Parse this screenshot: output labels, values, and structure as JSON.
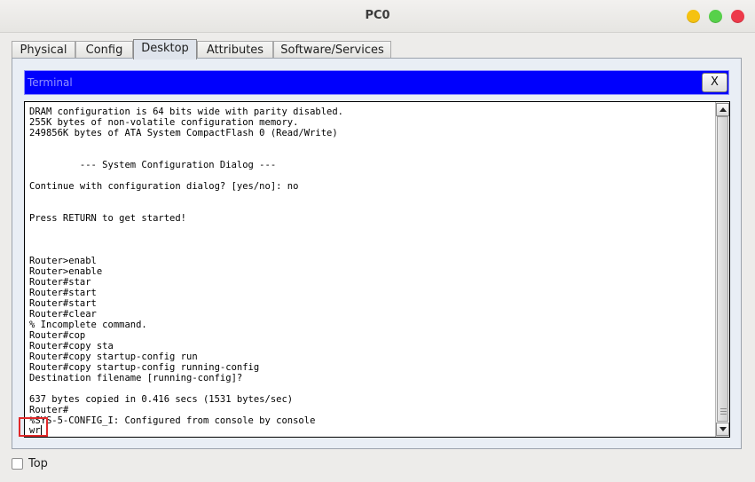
{
  "window": {
    "title": "PC0"
  },
  "tabs": [
    {
      "label": "Physical",
      "active": false
    },
    {
      "label": "Config",
      "active": false
    },
    {
      "label": "Desktop",
      "active": true
    },
    {
      "label": "Attributes",
      "active": false
    },
    {
      "label": "Software/Services",
      "active": false
    }
  ],
  "terminal": {
    "header_label": "Terminal",
    "close_label": "X",
    "output_lines": [
      "DRAM configuration is 64 bits wide with parity disabled.",
      "255K bytes of non-volatile configuration memory.",
      "249856K bytes of ATA System CompactFlash 0 (Read/Write)",
      "",
      "",
      "         --- System Configuration Dialog ---",
      "",
      "Continue with configuration dialog? [yes/no]: no",
      "",
      "",
      "Press RETURN to get started!",
      "",
      "",
      "",
      "Router>enabl",
      "Router>enable",
      "Router#star",
      "Router#start",
      "Router#start",
      "Router#clear",
      "% Incomplete command.",
      "Router#cop",
      "Router#copy sta",
      "Router#copy startup-config run",
      "Router#copy startup-config running-config",
      "Destination filename [running-config]?",
      "",
      "637 bytes copied in 0.416 secs (1531 bytes/sec)",
      "Router#",
      "%SYS-5-CONFIG_I: Configured from console by console"
    ],
    "input_value": "wr"
  },
  "footer": {
    "top_checkbox_label": "Top",
    "top_checked": false
  },
  "colors": {
    "terminal_header_bg": "#0000fd",
    "highlight_box": "#e0292a"
  }
}
